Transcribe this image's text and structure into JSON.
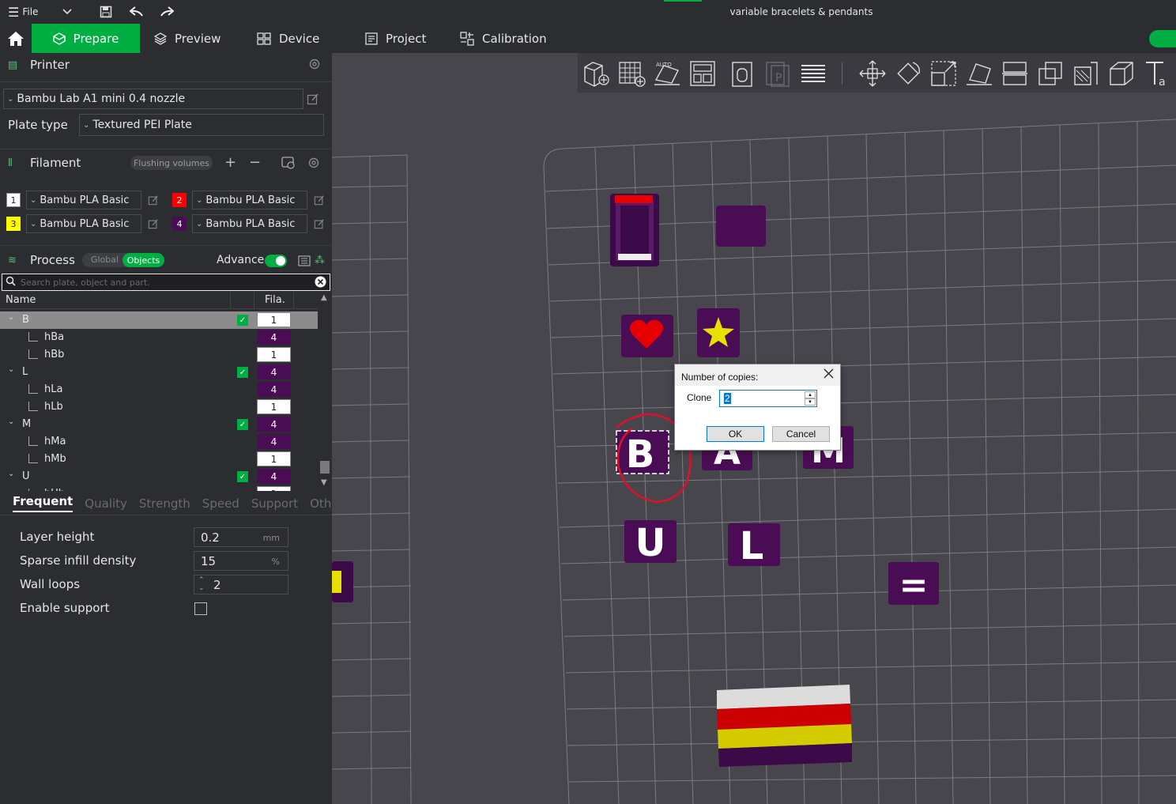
{
  "titlebar": {
    "file_label": "File",
    "window_title": "variable bracelets & pendants"
  },
  "tabs": {
    "prepare": "Prepare",
    "preview": "Preview",
    "device": "Device",
    "project": "Project",
    "calibration": "Calibration"
  },
  "printer": {
    "section_title": "Printer",
    "printer_name": "Bambu Lab A1 mini 0.4 nozzle",
    "plate_type_label": "Plate type",
    "plate_type_value": "Textured PEI Plate"
  },
  "filament": {
    "section_title": "Filament",
    "flushing_button": "Flushing volumes",
    "slots": [
      {
        "num": "1",
        "name": "Bambu PLA Basic",
        "color": "#ffffff"
      },
      {
        "num": "2",
        "name": "Bambu PLA Basic",
        "color": "#ff0000"
      },
      {
        "num": "3",
        "name": "Bambu PLA Basic",
        "color": "#ffff00"
      },
      {
        "num": "4",
        "name": "Bambu PLA Basic",
        "color": "#4a0d55"
      }
    ]
  },
  "process": {
    "section_title": "Process",
    "global_label": "Global",
    "objects_label": "Objects",
    "advance_label": "Advance",
    "search_placeholder": "Search plate, object and part."
  },
  "tree": {
    "col_name": "Name",
    "col_fila": "Fila.",
    "rows": [
      {
        "name": "B",
        "level": 0,
        "fila": "1",
        "selected": true
      },
      {
        "name": "hBa",
        "level": 1,
        "fila": "4"
      },
      {
        "name": "hBb",
        "level": 1,
        "fila": "1"
      },
      {
        "name": "L",
        "level": 0,
        "fila": "4"
      },
      {
        "name": "hLa",
        "level": 1,
        "fila": "4"
      },
      {
        "name": "hLb",
        "level": 1,
        "fila": "1"
      },
      {
        "name": "M",
        "level": 0,
        "fila": "4"
      },
      {
        "name": "hMa",
        "level": 1,
        "fila": "4"
      },
      {
        "name": "hMb",
        "level": 1,
        "fila": "1"
      },
      {
        "name": "U",
        "level": 0,
        "fila": "4"
      },
      {
        "name": "hUb",
        "level": 1,
        "fila": "1"
      }
    ]
  },
  "settings": {
    "tabs": [
      "Frequent",
      "Quality",
      "Strength",
      "Speed",
      "Support",
      "Others"
    ],
    "layer_height_label": "Layer height",
    "layer_height_value": "0.2",
    "layer_height_unit": "mm",
    "sparse_infill_label": "Sparse infill density",
    "sparse_infill_value": "15",
    "sparse_infill_unit": "%",
    "wall_loops_label": "Wall loops",
    "wall_loops_value": "2",
    "enable_support_label": "Enable support"
  },
  "plate": {
    "letters": [
      "B",
      "A",
      "M",
      "U",
      "L",
      "="
    ]
  },
  "dialog": {
    "title": "Number of copies:",
    "clone_label": "Clone",
    "clone_value": "2",
    "ok_label": "OK",
    "cancel_label": "Cancel"
  },
  "colors": {
    "accent": "#00ae42",
    "object_purple": "#4a0d55",
    "annotation_red": "#e0102a"
  }
}
